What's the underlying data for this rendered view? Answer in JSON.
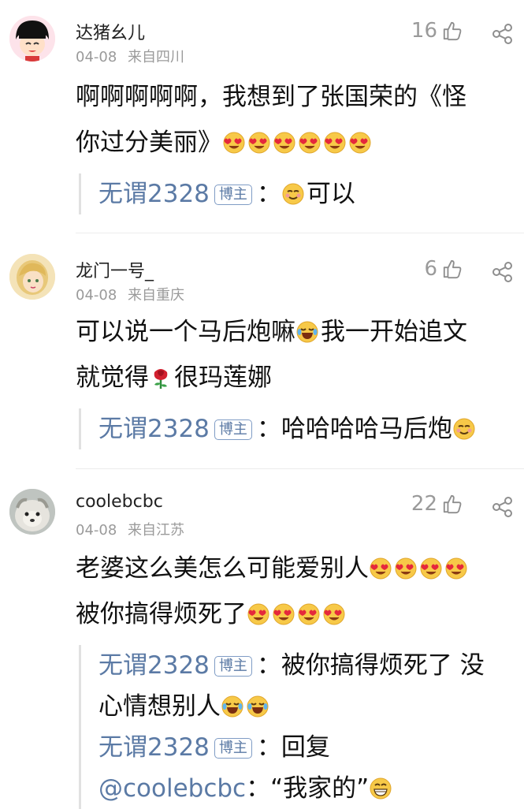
{
  "comments": [
    {
      "name": "达猪幺儿",
      "date": "04-08",
      "location": "来自四川",
      "likes": "16",
      "line1": "啊啊啊啊啊，我想到了张国荣的《怪",
      "line2": "你过分美丽》",
      "reply": {
        "user": "无谓2328",
        "badge": "博主",
        "sep": "：",
        "text": "可以"
      }
    },
    {
      "name": "龙门一号_",
      "date": "04-08",
      "location": "来自重庆",
      "likes": "6",
      "line1a": "可以说一个马后炮嘛",
      "line1b": "我一开始追文",
      "line2a": "就觉得",
      "line2b": "很玛莲娜",
      "reply": {
        "user": "无谓2328",
        "badge": "博主",
        "sep": "：",
        "text": "哈哈哈哈马后炮"
      }
    },
    {
      "name": "coolebcbc",
      "date": "04-08",
      "location": "来自江苏",
      "likes": "22",
      "line1": "老婆这么美怎么可能爱别人",
      "line2": "被你搞得烦死了",
      "replies": [
        {
          "user": "无谓2328",
          "badge": "博主",
          "sep": "：",
          "text1": "被你搞得烦死了 没",
          "text2": "心情想别人"
        },
        {
          "user": "无谓2328",
          "badge": "博主",
          "sep": "：",
          "text": "回复",
          "mention": "@coolebcbc",
          "sep2": "：",
          "quote": "“我家的”"
        }
      ]
    }
  ],
  "icons": {
    "like": "thumbs-up-icon",
    "share": "share-icon"
  },
  "colors": {
    "username_link": "#5b7aa5",
    "meta_gray": "#9a9a9a"
  }
}
